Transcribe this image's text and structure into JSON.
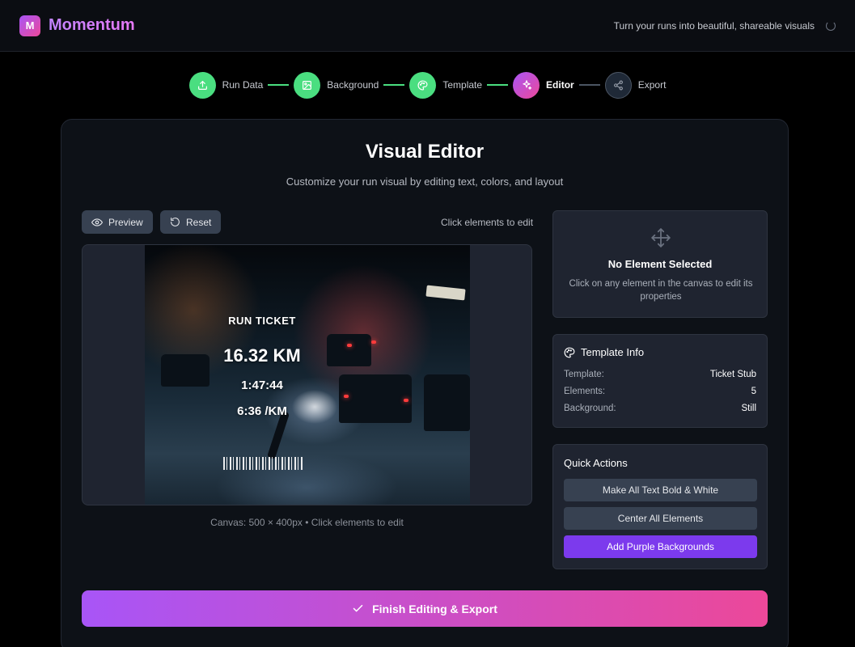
{
  "app": {
    "logo_letter": "M",
    "name": "Momentum",
    "tagline": "Turn your runs into beautiful, shareable visuals"
  },
  "stepper": {
    "steps": [
      {
        "label": "Run Data",
        "state": "done",
        "icon": "upload-icon"
      },
      {
        "label": "Background",
        "state": "done",
        "icon": "image-icon"
      },
      {
        "label": "Template",
        "state": "done",
        "icon": "palette-icon"
      },
      {
        "label": "Editor",
        "state": "active",
        "icon": "sparkles-icon"
      },
      {
        "label": "Export",
        "state": "todo",
        "icon": "share-icon"
      }
    ]
  },
  "editor": {
    "title": "Visual Editor",
    "subtitle": "Customize your run visual by editing text, colors, and layout",
    "preview_label": "Preview",
    "reset_label": "Reset",
    "hint": "Click elements to edit",
    "canvas_caption": "Canvas: 500 × 400px • Click elements to edit"
  },
  "canvas": {
    "ticket_title": "RUN TICKET",
    "distance": "16.32 KM",
    "time": "1:47:44",
    "pace": "6:36 /KM"
  },
  "selection": {
    "title": "No Element Selected",
    "description": "Click on any element in the canvas to edit its properties"
  },
  "template_info": {
    "heading": "Template Info",
    "rows": [
      {
        "key": "Template:",
        "value": "Ticket Stub"
      },
      {
        "key": "Elements:",
        "value": "5"
      },
      {
        "key": "Background:",
        "value": "Still"
      }
    ]
  },
  "quick_actions": {
    "heading": "Quick Actions",
    "bold_white": "Make All Text Bold & White",
    "center_all": "Center All Elements",
    "purple_bg": "Add Purple Backgrounds"
  },
  "finish": {
    "label": "Finish Editing & Export"
  },
  "colors": {
    "accent_purple": "#a855f7",
    "accent_pink": "#ec4899",
    "done_green": "#4ade80"
  }
}
